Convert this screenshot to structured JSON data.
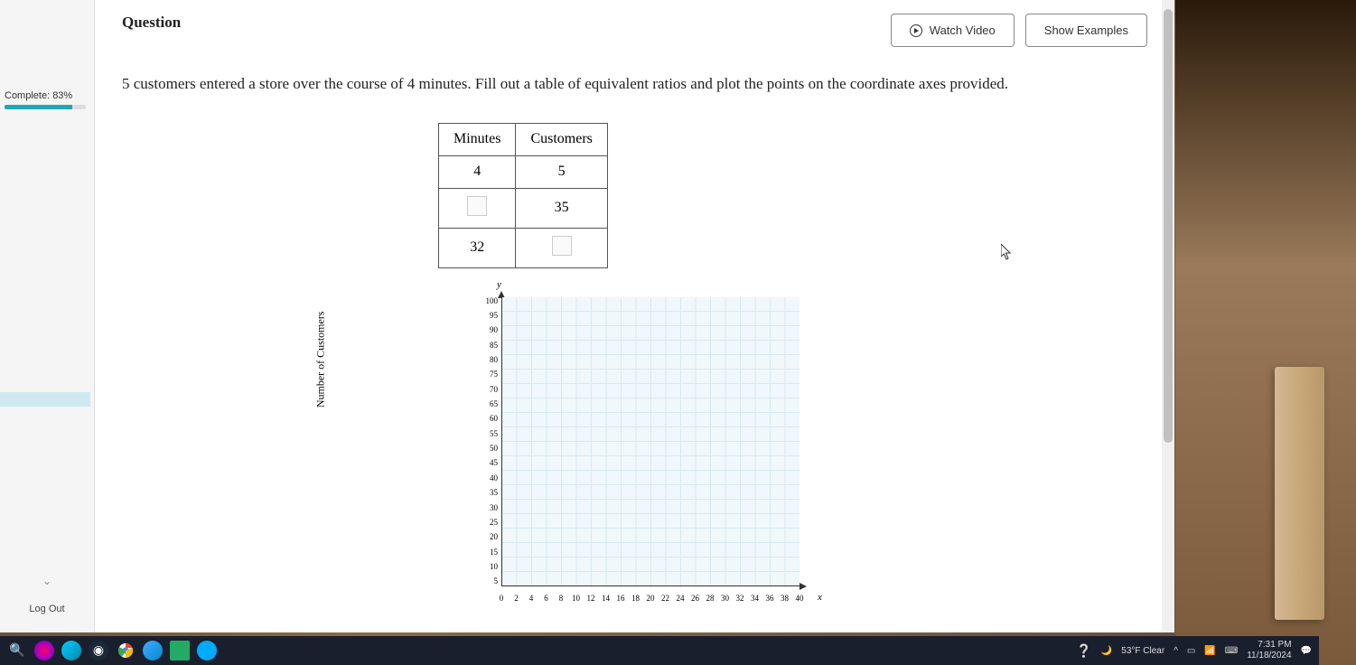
{
  "sidebar": {
    "complete_label": "Complete: 83%",
    "progress_percent": 83,
    "logout_label": "Log Out"
  },
  "header": {
    "title": "Question",
    "watch_video_label": "Watch Video",
    "show_examples_label": "Show Examples"
  },
  "question": {
    "text": "5 customers entered a store over the course of 4 minutes. Fill out a table of equivalent ratios and plot the points on the coordinate axes provided."
  },
  "table": {
    "col1_header": "Minutes",
    "col2_header": "Customers",
    "rows": [
      {
        "minutes": "4",
        "customers": "5",
        "minutes_input": false,
        "customers_input": false
      },
      {
        "minutes": "",
        "customers": "35",
        "minutes_input": true,
        "customers_input": false
      },
      {
        "minutes": "32",
        "customers": "",
        "minutes_input": false,
        "customers_input": true
      }
    ]
  },
  "chart_data": {
    "type": "scatter",
    "title": "",
    "xlabel": "",
    "ylabel": "Number of Customers",
    "y_letter": "y",
    "x_letter": "x",
    "xlim": [
      0,
      40
    ],
    "ylim": [
      0,
      100
    ],
    "x_ticks": [
      "0",
      "2",
      "4",
      "6",
      "8",
      "10",
      "12",
      "14",
      "16",
      "18",
      "20",
      "22",
      "24",
      "26",
      "28",
      "30",
      "32",
      "34",
      "36",
      "38",
      "40"
    ],
    "y_ticks": [
      "100",
      "95",
      "90",
      "85",
      "80",
      "75",
      "70",
      "65",
      "60",
      "55",
      "50",
      "45",
      "40",
      "35",
      "30",
      "25",
      "20",
      "15",
      "10",
      "5"
    ],
    "series": []
  },
  "taskbar": {
    "weather": "53°F Clear",
    "time": "7:31 PM",
    "date": "11/18/2024"
  }
}
